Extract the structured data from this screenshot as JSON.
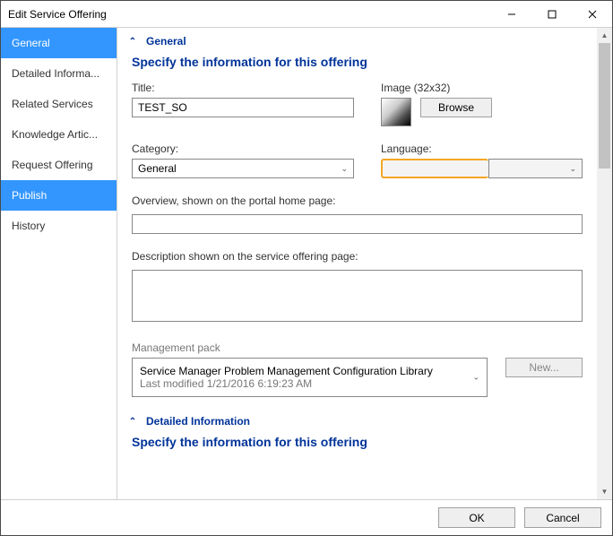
{
  "window": {
    "title": "Edit Service Offering"
  },
  "sidebar": {
    "items": [
      {
        "label": "General"
      },
      {
        "label": "Detailed Informa..."
      },
      {
        "label": "Related Services"
      },
      {
        "label": "Knowledge Artic..."
      },
      {
        "label": "Request Offering"
      },
      {
        "label": "Publish"
      },
      {
        "label": "History"
      }
    ]
  },
  "sections": {
    "general": {
      "title": "General",
      "subtitle": "Specify the information for this offering"
    },
    "detailed": {
      "title": "Detailed Information",
      "subtitle": "Specify the information for this offering"
    }
  },
  "form": {
    "title_label": "Title:",
    "title_value": "TEST_SO",
    "image_label": "Image (32x32)",
    "browse_label": "Browse",
    "category_label": "Category:",
    "category_value": "General",
    "language_label": "Language:",
    "language_value": "",
    "overview_label": "Overview, shown on the portal home page:",
    "overview_value": "",
    "description_label": "Description shown on the service offering page:",
    "description_value": "",
    "mp_label": "Management pack",
    "mp_value": "Service Manager Problem Management Configuration Library",
    "mp_modified_prefix": "Last modified  ",
    "mp_modified_value": "1/21/2016 6:19:23 AM",
    "new_label": "New..."
  },
  "footer": {
    "ok": "OK",
    "cancel": "Cancel"
  }
}
